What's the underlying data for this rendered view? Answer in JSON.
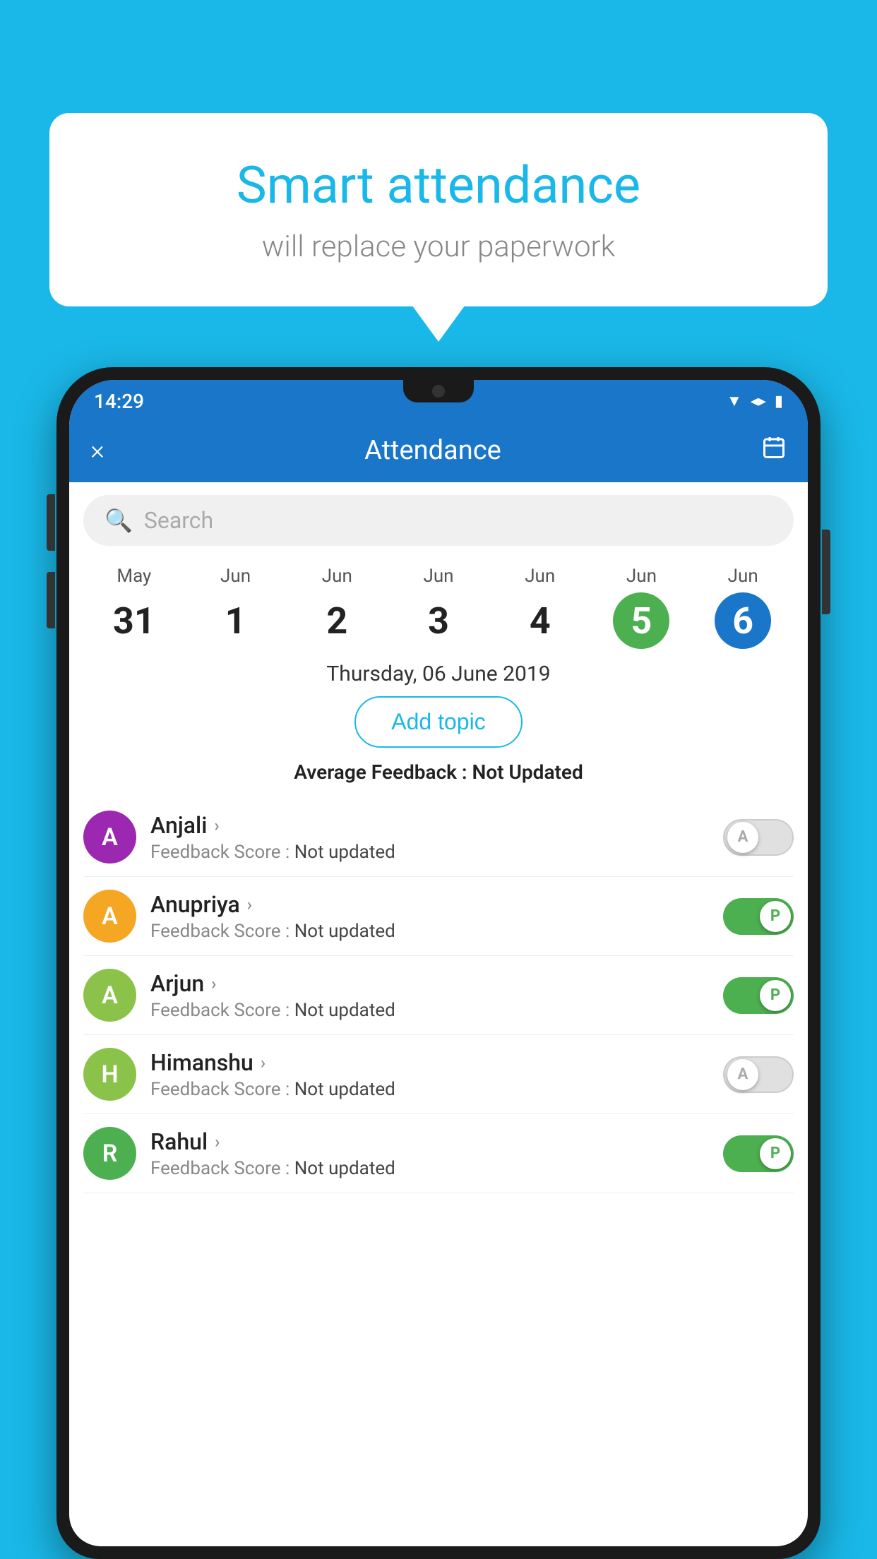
{
  "background_color": "#1ab8e8",
  "speech_bubble": {
    "title": "Smart attendance",
    "subtitle": "will replace your paperwork"
  },
  "status_bar": {
    "time": "14:29"
  },
  "header": {
    "title": "Attendance",
    "close_label": "×",
    "calendar_icon": "📅"
  },
  "search": {
    "placeholder": "Search"
  },
  "calendar": {
    "days": [
      {
        "month": "May",
        "date": "31",
        "state": "normal"
      },
      {
        "month": "Jun",
        "date": "1",
        "state": "normal"
      },
      {
        "month": "Jun",
        "date": "2",
        "state": "normal"
      },
      {
        "month": "Jun",
        "date": "3",
        "state": "normal"
      },
      {
        "month": "Jun",
        "date": "4",
        "state": "normal"
      },
      {
        "month": "Jun",
        "date": "5",
        "state": "today"
      },
      {
        "month": "Jun",
        "date": "6",
        "state": "selected"
      }
    ],
    "selected_date_label": "Thursday, 06 June 2019"
  },
  "add_topic_button": "Add topic",
  "average_feedback": {
    "label": "Average Feedback : ",
    "value": "Not Updated"
  },
  "students": [
    {
      "name": "Anjali",
      "avatar_letter": "A",
      "avatar_color": "#9c27b0",
      "feedback_label": "Feedback Score : ",
      "feedback_value": "Not updated",
      "toggle_state": "off",
      "toggle_label": "A"
    },
    {
      "name": "Anupriya",
      "avatar_letter": "A",
      "avatar_color": "#f5a623",
      "feedback_label": "Feedback Score : ",
      "feedback_value": "Not updated",
      "toggle_state": "on",
      "toggle_label": "P"
    },
    {
      "name": "Arjun",
      "avatar_letter": "A",
      "avatar_color": "#8bc34a",
      "feedback_label": "Feedback Score : ",
      "feedback_value": "Not updated",
      "toggle_state": "on",
      "toggle_label": "P"
    },
    {
      "name": "Himanshu",
      "avatar_letter": "H",
      "avatar_color": "#8bc34a",
      "feedback_label": "Feedback Score : ",
      "feedback_value": "Not updated",
      "toggle_state": "off",
      "toggle_label": "A"
    },
    {
      "name": "Rahul",
      "avatar_letter": "R",
      "avatar_color": "#4caf50",
      "feedback_label": "Feedback Score : ",
      "feedback_value": "Not updated",
      "toggle_state": "on",
      "toggle_label": "P"
    }
  ]
}
